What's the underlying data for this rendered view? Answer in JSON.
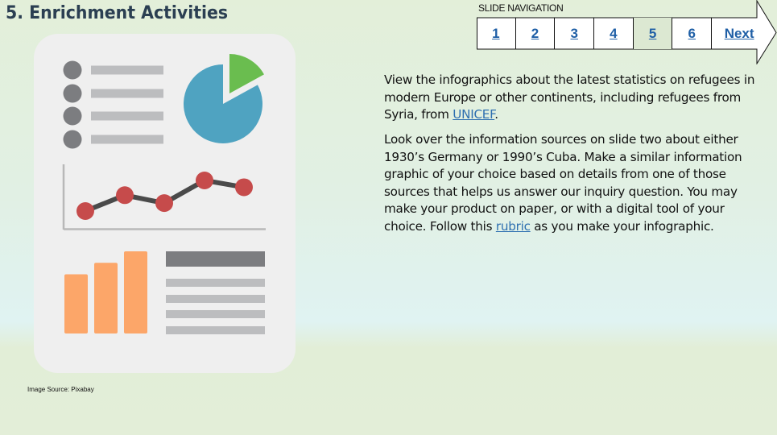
{
  "slide": {
    "title": "5. Enrichment Activities"
  },
  "navigation": {
    "label": "SLIDE NAVIGATION",
    "pages": [
      {
        "label": "1",
        "current": false
      },
      {
        "label": "2",
        "current": false
      },
      {
        "label": "3",
        "current": false
      },
      {
        "label": "4",
        "current": false
      },
      {
        "label": "5",
        "current": true
      },
      {
        "label": "6",
        "current": false
      }
    ],
    "next_label": "Next"
  },
  "content": {
    "paragraph1": {
      "before_link": "View the infographics about the latest statistics on refugees in modern Europe or other continents, including refugees from Syria,  from ",
      "link_text": "UNICEF",
      "after_link": "."
    },
    "paragraph2": {
      "before_link": "Look over the information sources on slide two about either 1930’s Germany or 1990’s Cuba. Make a similar information graphic of your choice based on details from one of those sources that helps us answer our inquiry question. You may make your product on paper, or with a digital tool of your choice. Follow this ",
      "link_text": "rubric",
      "after_link": " as you make your infographic."
    }
  },
  "image": {
    "caption": "Image Source: Pixabay",
    "alt": "infographic illustration",
    "colors": {
      "card": "#efefef",
      "bullet": "#7c7d80",
      "line_light": "#bcbdbf",
      "line_dark": "#7c7d80",
      "pie_main": "#4fa3c1",
      "pie_slice": "#6abd4f",
      "trend_line": "#4a4a4a",
      "trend_dot": "#c64b4b",
      "axis": "#b8b8b8",
      "bars": "#fca669"
    },
    "pie_slice_fraction": 0.17,
    "trend_values": [
      1,
      2.4,
      1.7,
      3.7,
      3.1
    ],
    "bar_values": [
      0.72,
      0.86,
      1.0
    ]
  },
  "colors": {
    "link": "#2d6fb0",
    "nav_link": "#1f5fa6",
    "nav_current_bg": "#dce8d2",
    "title": "#2b3f52"
  }
}
